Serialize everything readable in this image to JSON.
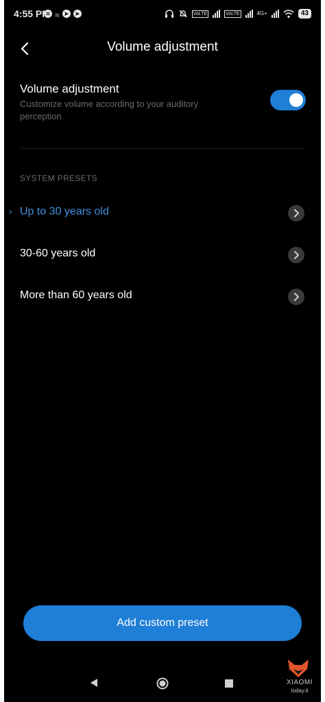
{
  "status_bar": {
    "time": "4:55 PM",
    "left_icons": [
      "spotify-icon",
      "wifi-share-icon",
      "telegram-icon",
      "telegram-icon"
    ],
    "right_icons": [
      "headphones-icon",
      "alarm-off-icon",
      "volte-signal-icon",
      "volte-signal-icon",
      "4g-signal-icon",
      "wifi-icon"
    ],
    "volte_label": "VoLTE",
    "network_label": "4G+",
    "battery": "43"
  },
  "header": {
    "title": "Volume adjustment"
  },
  "volume_setting": {
    "title": "Volume adjustment",
    "description": "Customize volume according to your auditory perception",
    "enabled": true
  },
  "presets": {
    "section_title": "SYSTEM PRESETS",
    "items": [
      {
        "label": "Up to 30 years old",
        "active": true
      },
      {
        "label": "30-60 years old",
        "active": false
      },
      {
        "label": "More than 60 years old",
        "active": false
      }
    ]
  },
  "actions": {
    "add_preset_label": "Add custom preset"
  },
  "watermark": {
    "brand": "XIAOMI",
    "site": "today.it"
  },
  "colors": {
    "accent": "#1f7ed6",
    "active_text": "#3f8fe0",
    "background": "#000000",
    "secondary_text": "#6b6b6b"
  }
}
